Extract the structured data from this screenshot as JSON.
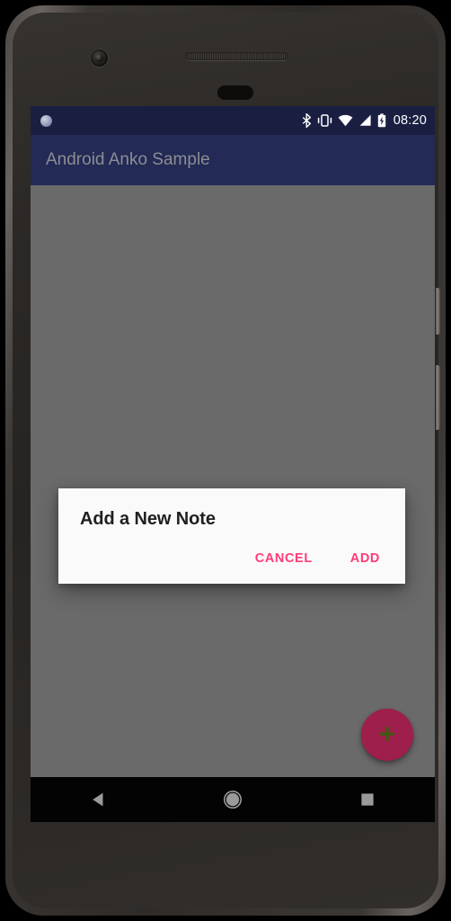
{
  "device": {
    "name": "android-phone-frame",
    "camera_icon": "front-camera-icon",
    "earpiece_icon": "earpiece-speaker-icon",
    "sensor_icon": "proximity-sensor-icon",
    "power_button_label": "",
    "volume_button_label": ""
  },
  "status_bar": {
    "notification_icon": "circle-notification-icon",
    "icons": [
      "bluetooth-icon",
      "vibrate-icon",
      "wifi-icon",
      "cellular-signal-icon",
      "battery-charging-icon"
    ],
    "clock": "08:20",
    "background_color": "#1a1f42",
    "foreground_color": "#ffffff"
  },
  "app_bar": {
    "title": "Android Anko Sample",
    "background_color": "#222a55",
    "title_color": "#8d8d93"
  },
  "content": {
    "background_color": "#6a6a6a",
    "items": []
  },
  "fab": {
    "name": "add-note-fab",
    "icon": "plus-icon",
    "background_color": "#9e1f4c",
    "icon_color": "#3f5a0d"
  },
  "dialog": {
    "title": "Add a New Note",
    "background_color": "#fafafa",
    "title_color": "#1f1f1f",
    "accent_color": "#ff3d77",
    "buttons": [
      {
        "label": "CANCEL",
        "name": "dialog-cancel-button"
      },
      {
        "label": "ADD",
        "name": "dialog-add-button"
      }
    ]
  },
  "nav_bar": {
    "background_color": "#030303",
    "icon_color": "#9a9a9a",
    "buttons": [
      {
        "name": "nav-back-button",
        "icon": "back-triangle-icon"
      },
      {
        "name": "nav-home-button",
        "icon": "home-circle-icon"
      },
      {
        "name": "nav-recents-button",
        "icon": "recents-square-icon"
      }
    ]
  }
}
